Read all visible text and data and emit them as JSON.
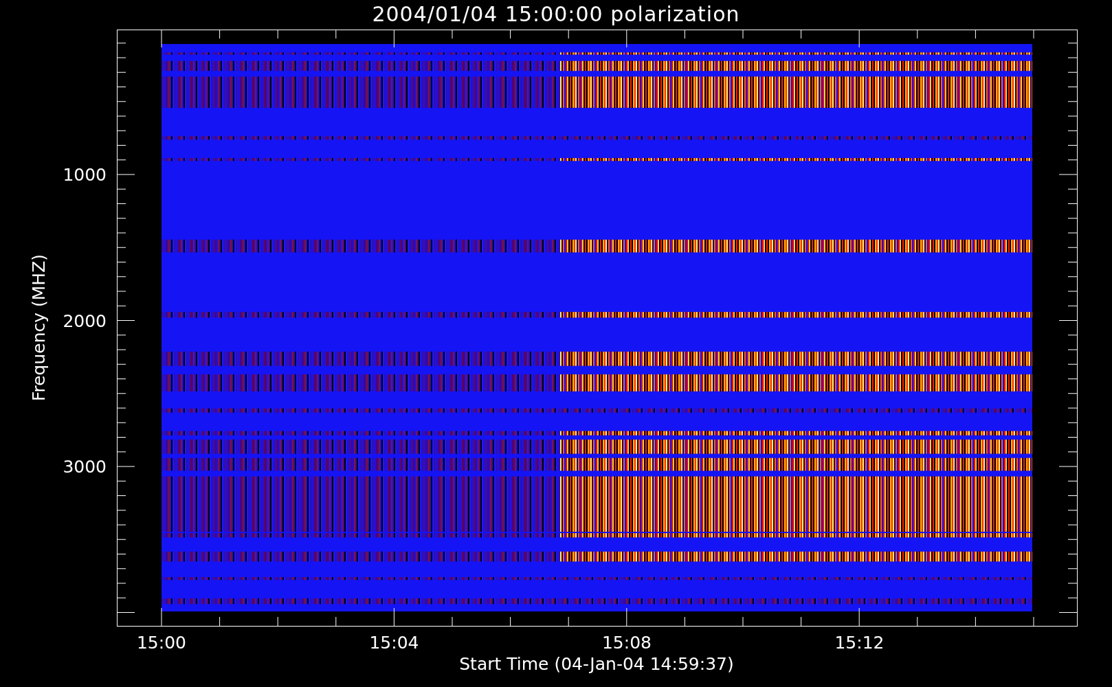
{
  "title": "2004/01/04 15:00:00 polarization",
  "y_axis": {
    "label": "Frequency (MHZ)",
    "ticks": [
      "1000",
      "2000",
      "3000"
    ]
  },
  "x_axis": {
    "label": "Start Time (04-Jan-04 14:59:37)",
    "ticks": [
      "15:00",
      "15:04",
      "15:08",
      "15:12"
    ]
  }
}
